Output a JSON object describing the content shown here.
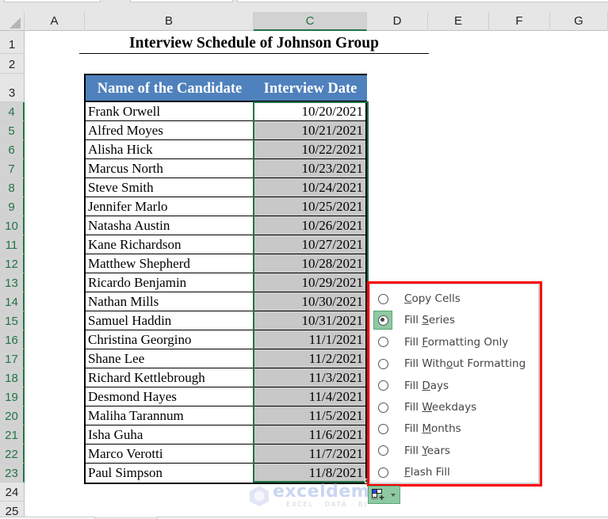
{
  "columns": [
    "A",
    "B",
    "C",
    "D",
    "E",
    "F",
    "G"
  ],
  "selected_column": "C",
  "rows": [
    "1",
    "2",
    "3",
    "4",
    "5",
    "6",
    "7",
    "8",
    "9",
    "10",
    "11",
    "12",
    "13",
    "14",
    "15",
    "16",
    "17",
    "18",
    "19",
    "20",
    "21",
    "22",
    "23",
    "24",
    "25"
  ],
  "title": "Interview Schedule of Johnson Group",
  "table": {
    "headers": [
      "Name of the Candidate",
      "Interview Date"
    ],
    "rows": [
      {
        "name": "Frank Orwell",
        "date": "10/20/2021"
      },
      {
        "name": "Alfred Moyes",
        "date": "10/21/2021"
      },
      {
        "name": "Alisha Hick",
        "date": "10/22/2021"
      },
      {
        "name": "Marcus North",
        "date": "10/23/2021"
      },
      {
        "name": "Steve Smith",
        "date": "10/24/2021"
      },
      {
        "name": "Jennifer Marlo",
        "date": "10/25/2021"
      },
      {
        "name": "Natasha Austin",
        "date": "10/26/2021"
      },
      {
        "name": "Kane Richardson",
        "date": "10/27/2021"
      },
      {
        "name": "Matthew Shepherd",
        "date": "10/28/2021"
      },
      {
        "name": "Ricardo Benjamin",
        "date": "10/29/2021"
      },
      {
        "name": "Nathan Mills",
        "date": "10/30/2021"
      },
      {
        "name": "Samuel Haddin",
        "date": "10/31/2021"
      },
      {
        "name": "Christina Georgino",
        "date": "11/1/2021"
      },
      {
        "name": "Shane Lee",
        "date": "11/2/2021"
      },
      {
        "name": "Richard Kettlebrough",
        "date": "11/3/2021"
      },
      {
        "name": "Desmond Hayes",
        "date": "11/4/2021"
      },
      {
        "name": "Maliha Tarannum",
        "date": "11/5/2021"
      },
      {
        "name": "Isha Guha",
        "date": "11/6/2021"
      },
      {
        "name": "Marco Verotti",
        "date": "11/7/2021"
      },
      {
        "name": "Paul Simpson",
        "date": "11/8/2021"
      }
    ]
  },
  "autofill_menu": {
    "selected": "Fill Series",
    "items": [
      {
        "label": "Copy Cells",
        "pre": "",
        "ul": "C",
        "post": "opy Cells",
        "checked": false
      },
      {
        "label": "Fill Series",
        "pre": "Fill ",
        "ul": "S",
        "post": "eries",
        "checked": true
      },
      {
        "label": "Fill Formatting Only",
        "pre": "Fill ",
        "ul": "F",
        "post": "ormatting Only",
        "checked": false
      },
      {
        "label": "Fill Without Formatting",
        "pre": "Fill With",
        "ul": "o",
        "post": "ut Formatting",
        "checked": false
      },
      {
        "label": "Fill Days",
        "pre": "Fill ",
        "ul": "D",
        "post": "ays",
        "checked": false
      },
      {
        "label": "Fill Weekdays",
        "pre": "Fill ",
        "ul": "W",
        "post": "eekdays",
        "checked": false
      },
      {
        "label": "Fill Months",
        "pre": "Fill ",
        "ul": "M",
        "post": "onths",
        "checked": false
      },
      {
        "label": "Fill Years",
        "pre": "Fill ",
        "ul": "Y",
        "post": "ears",
        "checked": false
      },
      {
        "label": "Flash Fill",
        "pre": "",
        "ul": "F",
        "post": "lash Fill",
        "checked": false
      }
    ]
  },
  "autofill_button": {
    "icon": "auto-fill-options-icon"
  },
  "watermark": {
    "brand": "exceldemy",
    "tagline": "EXCEL · DATA · BI"
  },
  "colors": {
    "header_fill": "#4f81bd",
    "selection": "#217346",
    "highlight_box": "#ff0000",
    "filled_cell": "#c8c8c8"
  }
}
